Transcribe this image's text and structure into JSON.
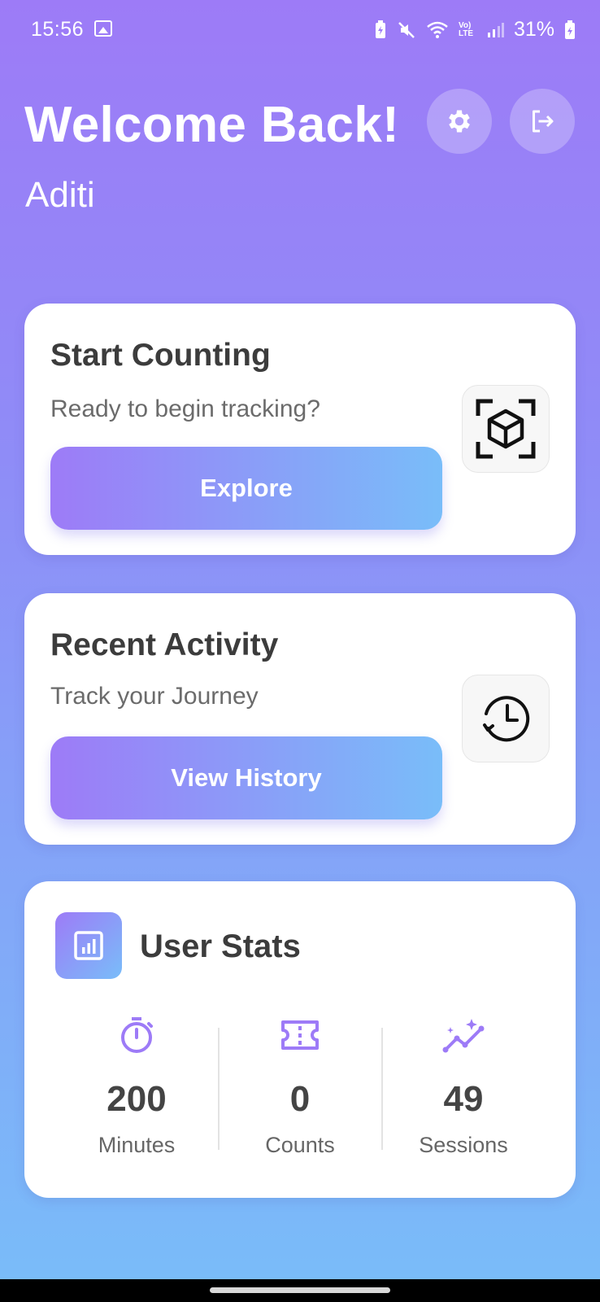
{
  "status_bar": {
    "time": "15:56",
    "battery": "31%",
    "volte": "Vo) LTE"
  },
  "header": {
    "title": "Welcome Back!",
    "user_name": "Aditi"
  },
  "start_card": {
    "title": "Start Counting",
    "subtitle": "Ready to begin tracking?",
    "button_label": "Explore"
  },
  "recent_card": {
    "title": "Recent Activity",
    "subtitle": "Track your Journey",
    "button_label": "View History"
  },
  "stats_card": {
    "title": "User Stats",
    "stats": [
      {
        "value": "200",
        "label": "Minutes",
        "icon": "timer-icon"
      },
      {
        "value": "0",
        "label": "Counts",
        "icon": "ticket-icon"
      },
      {
        "value": "49",
        "label": "Sessions",
        "icon": "trend-sparkle-icon"
      }
    ]
  },
  "colors": {
    "gradient_start": "#9d7bf7",
    "gradient_end": "#79bdf9",
    "accent_purple": "#9d7bf7",
    "card_text": "#3c3c3c"
  }
}
